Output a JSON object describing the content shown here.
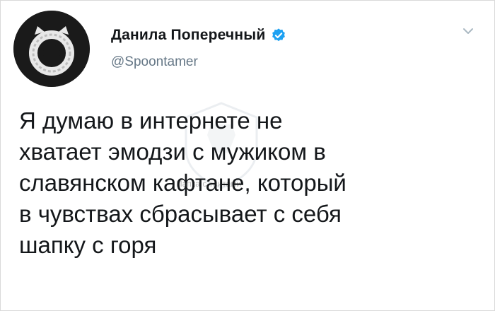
{
  "tweet": {
    "author_name": "Данила Поперечный",
    "handle": "@Spoontamer",
    "verified": true,
    "text": "Я думаю в интернете не\nхватает эмодзи с мужиком в\nславянском кафтане, который\nв чувствах сбрасывает с себя\nшапку с горя"
  },
  "watermark": {
    "text": "Папка с твитами"
  },
  "icons": {
    "verified": "verified-badge-icon",
    "menu": "chevron-down-icon",
    "avatar": "avatar-logo"
  },
  "colors": {
    "verified": "#1da1f2",
    "text": "#14171a",
    "secondary": "#657786",
    "avatar_bg": "#1a1a1a"
  }
}
